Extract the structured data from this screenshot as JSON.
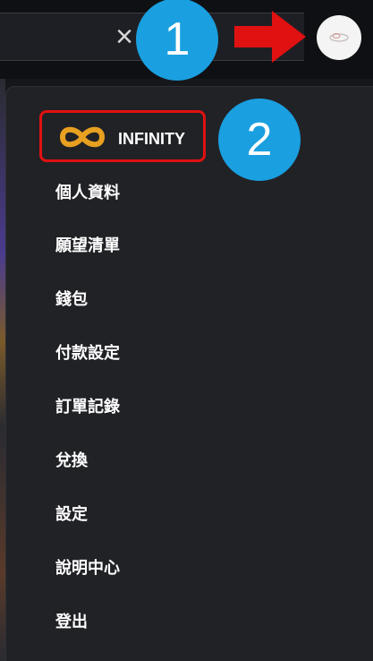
{
  "annotations": {
    "step1": "1",
    "step2": "2",
    "arrow_color": "#e01111",
    "badge_color": "#1a9fe0"
  },
  "search": {
    "clear_icon": "×",
    "clear_icon_name": "close-icon"
  },
  "menu": {
    "infinity_label": "INFINITY",
    "infinity_color": "#e8a020",
    "items": [
      "個人資料",
      "願望清單",
      "錢包",
      "付款設定",
      "訂單記錄",
      "兌換",
      "設定",
      "說明中心",
      "登出"
    ]
  }
}
